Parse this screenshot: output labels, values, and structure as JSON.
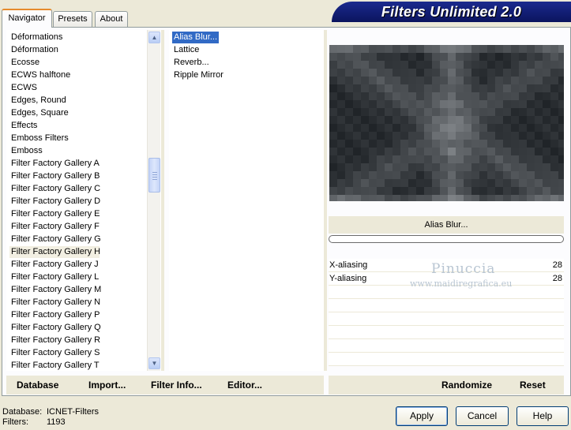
{
  "tabs": [
    {
      "label": "Navigator",
      "active": true
    },
    {
      "label": "Presets",
      "active": false
    },
    {
      "label": "About",
      "active": false
    }
  ],
  "brand": {
    "title": "Filters Unlimited 2.0",
    "colors": {
      "banner": "#0b145e",
      "text": "#ffffff"
    }
  },
  "categories": {
    "items": [
      "Déformations",
      "Déformation",
      "Ecosse",
      "ECWS halftone",
      "ECWS",
      "Edges, Round",
      "Edges, Square",
      "Effects",
      "Emboss Filters",
      "Emboss",
      "Filter Factory Gallery A",
      "Filter Factory Gallery B",
      "Filter Factory Gallery C",
      "Filter Factory Gallery D",
      "Filter Factory Gallery E",
      "Filter Factory Gallery F",
      "Filter Factory Gallery G",
      "Filter Factory Gallery H",
      "Filter Factory Gallery J",
      "Filter Factory Gallery L",
      "Filter Factory Gallery M",
      "Filter Factory Gallery N",
      "Filter Factory Gallery P",
      "Filter Factory Gallery Q",
      "Filter Factory Gallery R",
      "Filter Factory Gallery S",
      "Filter Factory Gallery T"
    ],
    "selected": "Filter Factory Gallery H"
  },
  "filters": {
    "items": [
      "Alias Blur...",
      "Lattice",
      "Reverb...",
      "Ripple Mirror"
    ],
    "selected": "Alias Blur..."
  },
  "preview": {
    "filter_name": "Alias Blur..."
  },
  "params": [
    {
      "label": "X-aliasing",
      "value": "28"
    },
    {
      "label": "Y-aliasing",
      "value": "28"
    }
  ],
  "watermark": {
    "line1": "Pinuccia",
    "line2": "www.maidiregrafica.eu"
  },
  "links": {
    "database": "Database",
    "import": "Import...",
    "filter_info": "Filter Info...",
    "editor": "Editor...",
    "randomize": "Randomize",
    "reset": "Reset"
  },
  "status": {
    "database_label": "Database:",
    "database_value": "ICNET-Filters",
    "filters_label": "Filters:",
    "filters_value": "1193"
  },
  "buttons": {
    "apply": "Apply",
    "cancel": "Cancel",
    "help": "Help"
  },
  "icons": {
    "scroll_up": "scroll-up-arrow-icon",
    "scroll_down": "scroll-down-arrow-icon"
  }
}
